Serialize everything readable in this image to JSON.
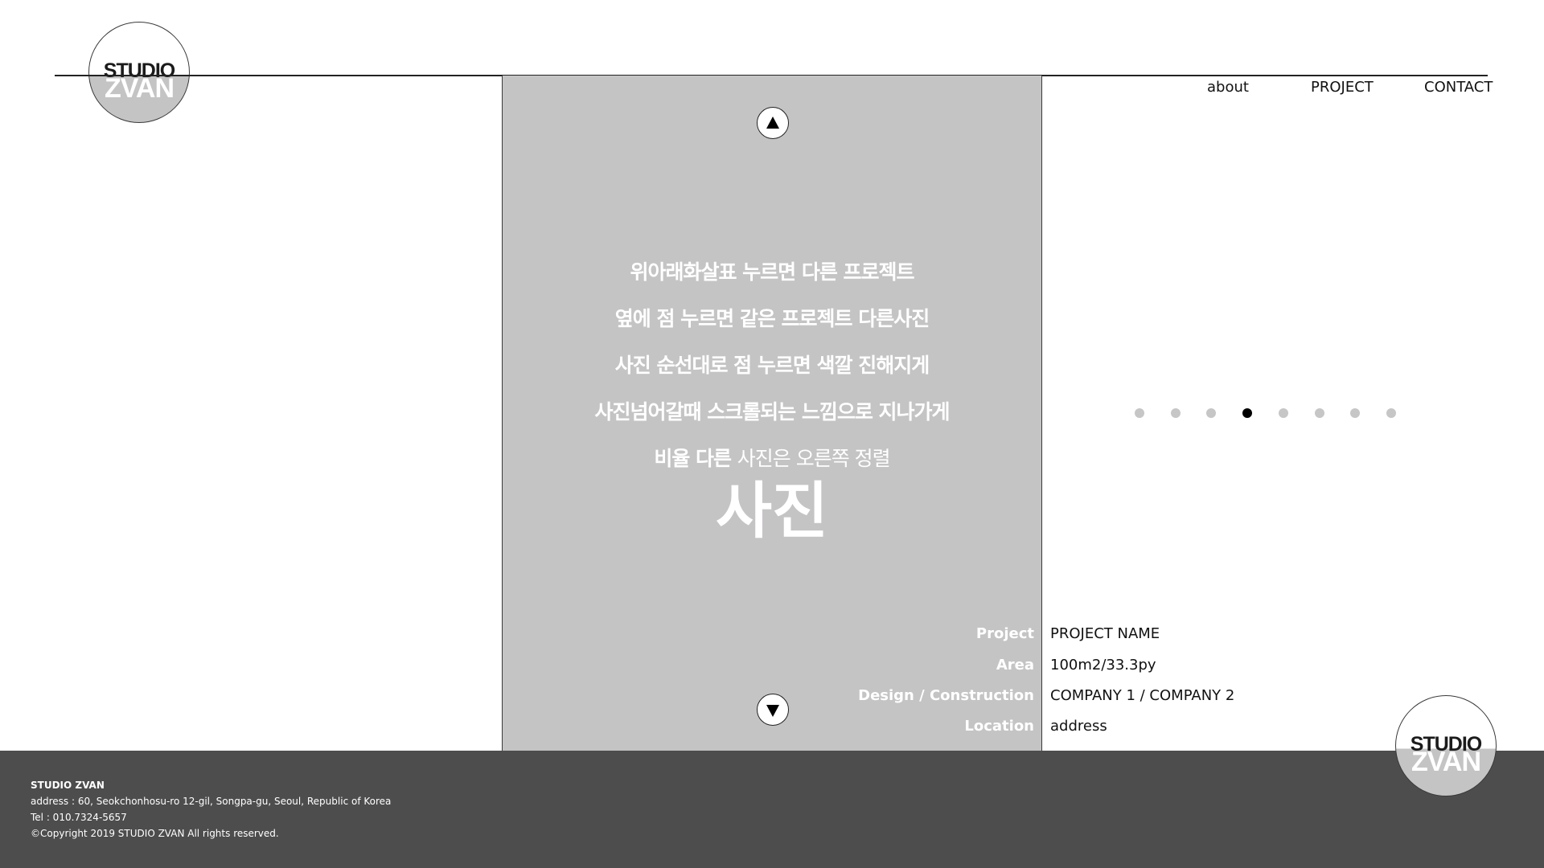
{
  "brand": {
    "line1": "STUDIO",
    "line2": "ZVAN"
  },
  "nav": {
    "about": "about",
    "project": "PROJECT",
    "contact": "CONTACT"
  },
  "photo": {
    "lines": [
      "위아래화살표 누르면 다른 프로젝트",
      "옆에 점 누르면 같은 프로젝트 다른사진",
      "사진 순선대로 점 누르면 색깔 진해지게",
      "사진넘어갈때 스크롤되는 느낌으로 지나가게"
    ],
    "line5_bold": "비율 다른",
    "line5_light": "사진은 오른쪽 정렬",
    "big_word": "사진"
  },
  "pagination": {
    "total": 8,
    "active_index": 3
  },
  "project_info": {
    "rows": [
      {
        "label": "Project",
        "value": "PROJECT NAME"
      },
      {
        "label": "Area",
        "value": "100m2/33.3py"
      },
      {
        "label": "Design / Construction",
        "value": "COMPANY 1 / COMPANY 2"
      },
      {
        "label": "Location",
        "value": "address"
      }
    ]
  },
  "footer": {
    "name": "STUDIO ZVAN",
    "address": "address : 60, Seokchonhosu-ro 12-gil, Songpa-gu, Seoul, Republic of Korea",
    "tel": "Tel : 010.7324-5657",
    "copyright": "©Copyright 2019 STUDIO ZVAN All rights reserved."
  },
  "colors": {
    "photo_placeholder": "#c5c4c5",
    "footer_bg": "#4d4d4d",
    "dot_inactive": "#c6c6c6",
    "dot_active": "#000000"
  },
  "icons": [
    "arrow-up-icon",
    "arrow-down-icon",
    "logo"
  ]
}
